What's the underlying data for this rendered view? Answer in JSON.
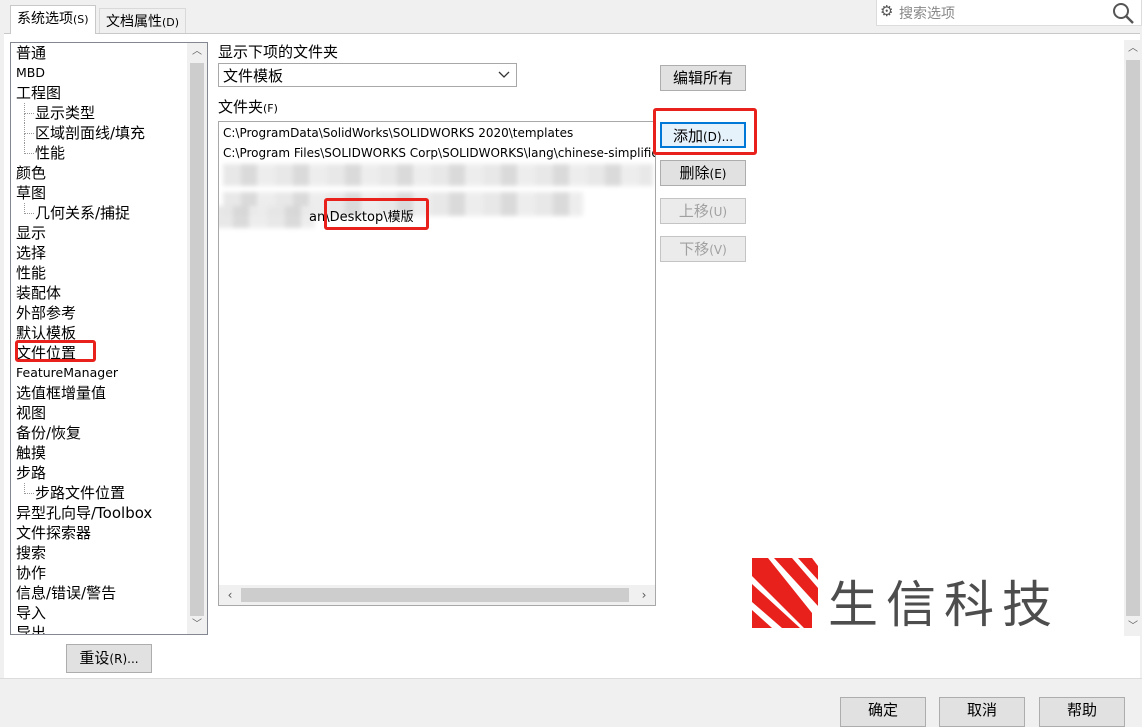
{
  "tabs": [
    {
      "label": "系统选项",
      "accel": "(S)",
      "active": true
    },
    {
      "label": "文档属性",
      "accel": "(D)",
      "active": false
    }
  ],
  "search": {
    "placeholder": "搜索选项"
  },
  "tree": {
    "items": [
      {
        "label": "普通",
        "level": 0
      },
      {
        "label": "MBD",
        "level": 0
      },
      {
        "label": "工程图",
        "level": 0
      },
      {
        "label": "显示类型",
        "level": 1
      },
      {
        "label": "区域剖面线/填充",
        "level": 1
      },
      {
        "label": "性能",
        "level": 1
      },
      {
        "label": "颜色",
        "level": 0
      },
      {
        "label": "草图",
        "level": 0
      },
      {
        "label": "几何关系/捕捉",
        "level": 1
      },
      {
        "label": "显示",
        "level": 0
      },
      {
        "label": "选择",
        "level": 0
      },
      {
        "label": "性能",
        "level": 0
      },
      {
        "label": "装配体",
        "level": 0
      },
      {
        "label": "外部参考",
        "level": 0
      },
      {
        "label": "默认模板",
        "level": 0
      },
      {
        "label": "文件位置",
        "level": 0
      },
      {
        "label": "FeatureManager",
        "level": 0
      },
      {
        "label": "选值框增量值",
        "level": 0
      },
      {
        "label": "视图",
        "level": 0
      },
      {
        "label": "备份/恢复",
        "level": 0
      },
      {
        "label": "触摸",
        "level": 0
      },
      {
        "label": "步路",
        "level": 0
      },
      {
        "label": "步路文件位置",
        "level": 1
      },
      {
        "label": "异型孔向导/Toolbox",
        "level": 0
      },
      {
        "label": "文件探索器",
        "level": 0
      },
      {
        "label": "搜索",
        "level": 0
      },
      {
        "label": "协作",
        "level": 0
      },
      {
        "label": "信息/错误/警告",
        "level": 0
      },
      {
        "label": "导入",
        "level": 0
      },
      {
        "label": "导出",
        "level": 0
      }
    ]
  },
  "show_folders_for": {
    "label": "显示下项的文件夹",
    "selected": "文件模板"
  },
  "folders": {
    "label": "文件夹",
    "accel": "(F)",
    "rows": [
      "C:\\ProgramData\\SolidWorks\\SOLIDWORKS 2020\\templates",
      "C:\\Program Files\\SOLIDWORKS Corp\\SOLIDWORKS\\lang\\chinese-simplified",
      "an\\Desktop\\模版"
    ]
  },
  "buttons": {
    "edit_all": {
      "label": "编辑所有"
    },
    "add": {
      "label": "添加",
      "accel": "(D)..."
    },
    "delete": {
      "label": "删除",
      "accel": "(E)"
    },
    "move_up": {
      "label": "上移",
      "accel": "(U)"
    },
    "move_down": {
      "label": "下移",
      "accel": "(V)"
    },
    "reset": {
      "label": "重设",
      "accel": "(R)..."
    },
    "ok": {
      "label": "确定"
    },
    "cancel": {
      "label": "取消"
    },
    "help": {
      "label": "帮助"
    }
  },
  "watermark": {
    "text": "生信科技"
  },
  "colors": {
    "highlight": "#e8211d",
    "focus": "#0078d7"
  }
}
